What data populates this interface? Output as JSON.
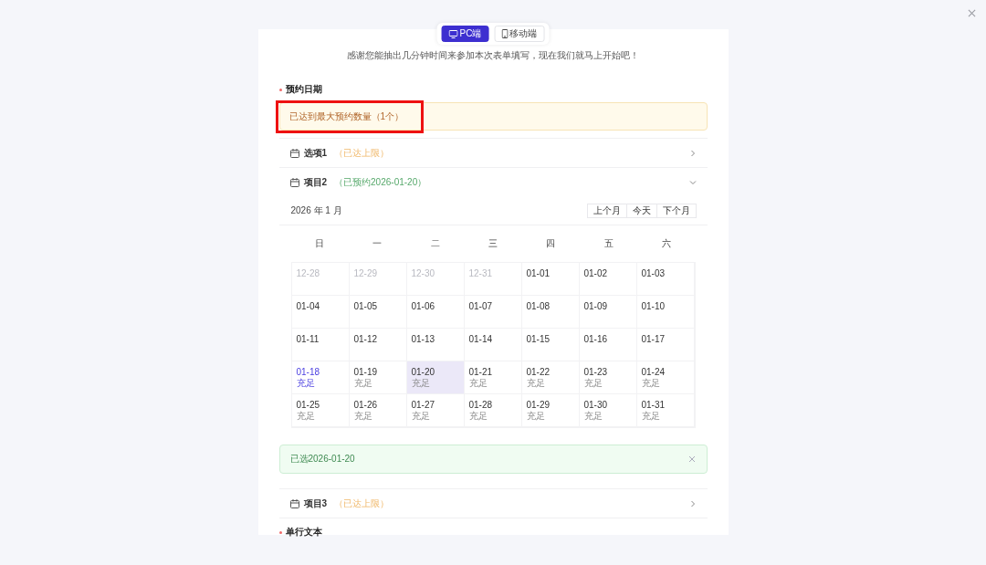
{
  "view_switch": [
    {
      "label": "PC端",
      "selected": true
    },
    {
      "label": "移动端",
      "selected": false
    }
  ],
  "intro": "感谢您能抽出几分钟时间来参加本次表单填写，现在我们就马上开始吧！",
  "field": {
    "label": "预约日期",
    "required": true
  },
  "warning": {
    "text": "已达到最大预约数量（1个）",
    "highlighted": true
  },
  "items": [
    {
      "title": "选项1",
      "status": "（已达上限）",
      "kind": "limit",
      "expanded": false
    },
    {
      "title": "项目2",
      "status": "（已预约2026-01-20）",
      "kind": "booked",
      "expanded": true,
      "calendar": {
        "month": "2026 年 1 月",
        "buttons": [
          "上个月",
          "今天",
          "下个月"
        ],
        "weekdays": [
          "日",
          "一",
          "二",
          "三",
          "四",
          "五",
          "六"
        ],
        "weeks": [
          [
            {
              "date": "12-28",
              "in_month": false,
              "today": false,
              "selected": false
            },
            {
              "date": "12-29",
              "in_month": false,
              "today": false,
              "selected": false
            },
            {
              "date": "12-30",
              "in_month": false,
              "today": false,
              "selected": false
            },
            {
              "date": "12-31",
              "in_month": false,
              "today": false,
              "selected": false
            },
            {
              "date": "01-01",
              "in_month": true,
              "today": false,
              "selected": false
            },
            {
              "date": "01-02",
              "in_month": true,
              "today": false,
              "selected": false
            },
            {
              "date": "01-03",
              "in_month": true,
              "today": false,
              "selected": false
            }
          ],
          [
            {
              "date": "01-04",
              "in_month": true,
              "today": false,
              "selected": false
            },
            {
              "date": "01-05",
              "in_month": true,
              "today": false,
              "selected": false
            },
            {
              "date": "01-06",
              "in_month": true,
              "today": false,
              "selected": false
            },
            {
              "date": "01-07",
              "in_month": true,
              "today": false,
              "selected": false
            },
            {
              "date": "01-08",
              "in_month": true,
              "today": false,
              "selected": false
            },
            {
              "date": "01-09",
              "in_month": true,
              "today": false,
              "selected": false
            },
            {
              "date": "01-10",
              "in_month": true,
              "today": false,
              "selected": false
            }
          ],
          [
            {
              "date": "01-11",
              "in_month": true,
              "today": false,
              "selected": false
            },
            {
              "date": "01-12",
              "in_month": true,
              "today": false,
              "selected": false
            },
            {
              "date": "01-13",
              "in_month": true,
              "today": false,
              "selected": false
            },
            {
              "date": "01-14",
              "in_month": true,
              "today": false,
              "selected": false
            },
            {
              "date": "01-15",
              "in_month": true,
              "today": false,
              "selected": false
            },
            {
              "date": "01-16",
              "in_month": true,
              "today": false,
              "selected": false
            },
            {
              "date": "01-17",
              "in_month": true,
              "today": false,
              "selected": false
            }
          ],
          [
            {
              "date": "01-18",
              "in_month": true,
              "today": true,
              "selected": false,
              "status": "充足"
            },
            {
              "date": "01-19",
              "in_month": true,
              "today": false,
              "selected": false,
              "status": "充足"
            },
            {
              "date": "01-20",
              "in_month": true,
              "today": false,
              "selected": true,
              "status": "充足"
            },
            {
              "date": "01-21",
              "in_month": true,
              "today": false,
              "selected": false,
              "status": "充足"
            },
            {
              "date": "01-22",
              "in_month": true,
              "today": false,
              "selected": false,
              "status": "充足"
            },
            {
              "date": "01-23",
              "in_month": true,
              "today": false,
              "selected": false,
              "status": "充足"
            },
            {
              "date": "01-24",
              "in_month": true,
              "today": false,
              "selected": false,
              "status": "充足"
            }
          ],
          [
            {
              "date": "01-25",
              "in_month": true,
              "today": false,
              "selected": false,
              "status": "充足"
            },
            {
              "date": "01-26",
              "in_month": true,
              "today": false,
              "selected": false,
              "status": "充足"
            },
            {
              "date": "01-27",
              "in_month": true,
              "today": false,
              "selected": false,
              "status": "充足"
            },
            {
              "date": "01-28",
              "in_month": true,
              "today": false,
              "selected": false,
              "status": "充足"
            },
            {
              "date": "01-29",
              "in_month": true,
              "today": false,
              "selected": false,
              "status": "充足"
            },
            {
              "date": "01-30",
              "in_month": true,
              "today": false,
              "selected": false,
              "status": "充足"
            },
            {
              "date": "01-31",
              "in_month": true,
              "today": false,
              "selected": false,
              "status": "充足"
            }
          ]
        ]
      },
      "notice": {
        "text": "已选2026-01-20",
        "closable": true
      }
    },
    {
      "title": "项目3",
      "status": "（已达上限）",
      "kind": "limit",
      "expanded": false
    }
  ],
  "next_field": {
    "label": "单行文本",
    "required": true
  }
}
